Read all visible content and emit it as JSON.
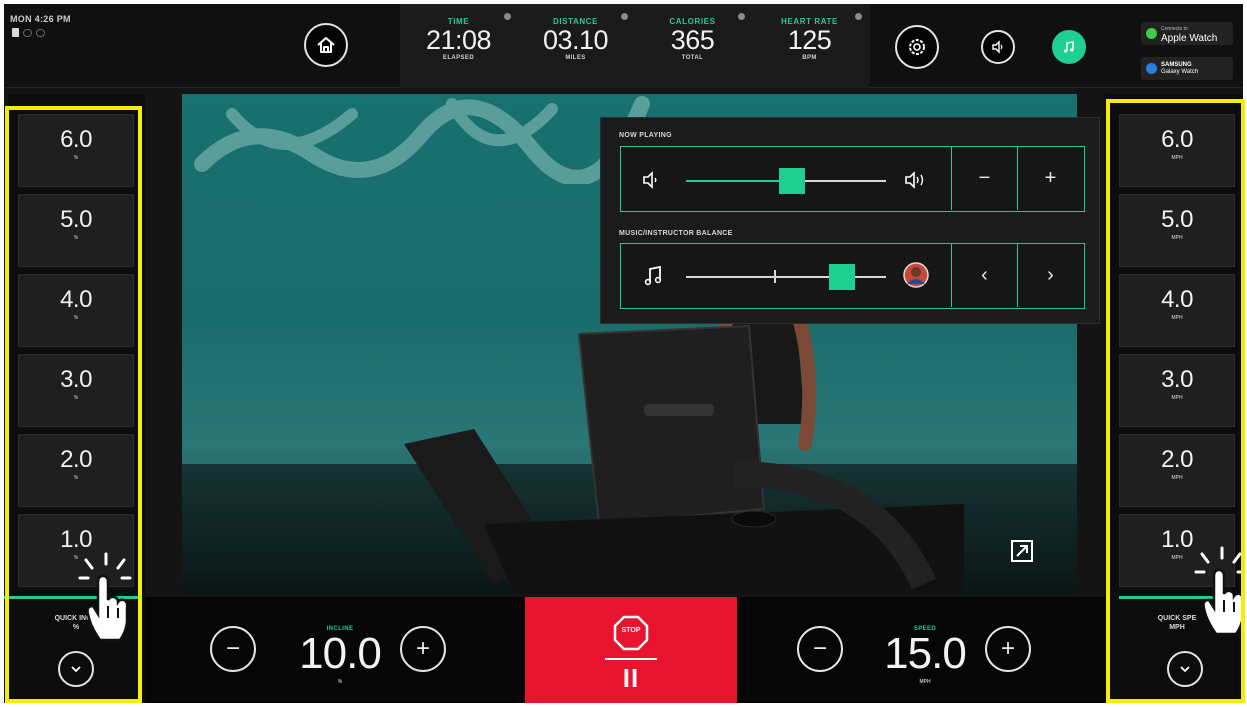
{
  "status": {
    "clock": "MON 4:26 PM"
  },
  "metrics": [
    {
      "label": "TIME",
      "value": "21:08",
      "unit": "ELAPSED"
    },
    {
      "label": "DISTANCE",
      "value": "03.10",
      "unit": "MILES"
    },
    {
      "label": "CALORIES",
      "value": "365",
      "unit": "TOTAL"
    },
    {
      "label": "HEART RATE",
      "value": "125",
      "unit": "BPM"
    }
  ],
  "watches": {
    "apple": {
      "small": "Connects to",
      "name": "Apple Watch"
    },
    "samsung": {
      "small": "SAMSUNG",
      "name": "Galaxy Watch"
    }
  },
  "quick_incline": {
    "label": "QUICK INCLI",
    "unit": "%",
    "values": [
      "6.0",
      "5.0",
      "4.0",
      "3.0",
      "2.0",
      "1.0"
    ],
    "value_unit": "%"
  },
  "quick_speed": {
    "label": "QUICK SPE",
    "unit": "MPH",
    "values": [
      "6.0",
      "5.0",
      "4.0",
      "3.0",
      "2.0",
      "1.0"
    ],
    "value_unit": "MPH"
  },
  "now_playing": {
    "title": "NOW PLAYING",
    "volume_level": 0.53,
    "minus": "−",
    "plus": "+",
    "balance_title": "MUSIC/INSTRUCTOR BALANCE",
    "balance_level": 0.78,
    "prev": "‹",
    "next": "›"
  },
  "controls": {
    "incline": {
      "label": "INCLINE",
      "value": "10.0",
      "unit": "%"
    },
    "speed": {
      "label": "SPEED",
      "value": "15.0",
      "unit": "MPH"
    },
    "stop_label": "STOP",
    "pause_glyph": "II",
    "minus": "−",
    "plus": "+"
  },
  "colors": {
    "accent": "#1fcf91",
    "stop": "#e8132e",
    "highlight": "#f4ef00"
  }
}
